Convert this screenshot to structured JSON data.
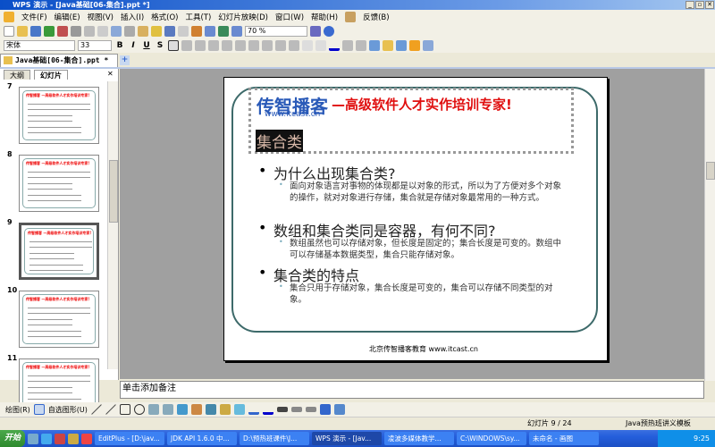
{
  "window": {
    "title": "WPS 演示 - [Java基础[06-集合].ppt *]",
    "min": "_",
    "max": "▫",
    "close": "✕"
  },
  "menu": [
    "文件(F)",
    "编辑(E)",
    "视图(V)",
    "插入(I)",
    "格式(O)",
    "工具(T)",
    "幻灯片放映(D)",
    "窗口(W)",
    "帮助(H)",
    "反馈(B)"
  ],
  "toolbar": {
    "zoom": "70 %",
    "font": "宋体",
    "size": "33",
    "bold": "B",
    "italic": "I",
    "underline": "U",
    "shadow": "S"
  },
  "doc_tab": {
    "label": "Java基础[06-集合].ppt",
    "modified": "*",
    "close": "✕",
    "new": "+"
  },
  "panel": {
    "tabs": [
      "大纲",
      "幻灯片"
    ],
    "close": "✕"
  },
  "thumbnails": [
    {
      "num": "7"
    },
    {
      "num": "8"
    },
    {
      "num": "9",
      "selected": true
    },
    {
      "num": "10"
    },
    {
      "num": "11"
    }
  ],
  "slide": {
    "logo": "传智播客",
    "logo_url": "www.itcast.cn",
    "slogan": "—高级软件人才实作培训专家!",
    "title": "集合类",
    "bullets": [
      {
        "text": "为什么出现集合类?",
        "sub": "面向对象语言对事物的体现都是以对象的形式，所以为了方便对多个对象的操作，就对对象进行存储，集合就是存储对象最常用的一种方式。"
      },
      {
        "text": "数组和集合类同是容器，有何不同?",
        "sub": "数组虽然也可以存储对象，但长度是固定的；集合长度是可变的。数组中可以存储基本数据类型，集合只能存储对象。"
      },
      {
        "text": "集合类的特点",
        "sub": "集合只用于存储对象，集合长度是可变的，集合可以存储不同类型的对象。"
      }
    ],
    "footer": "北京传智播客教育 www.itcast.cn"
  },
  "notes": {
    "placeholder": "单击添加备注"
  },
  "drawbar": {
    "draw": "绘图(R)",
    "autoshapes": "自选图形(U)"
  },
  "status": {
    "slide": "幻灯片 9 / 24",
    "template": "Java预热班讲义模板"
  },
  "taskbar": {
    "start": "开始",
    "tasks": [
      "EditPlus - [D:\\jav...",
      "JDK API 1.6.0 中...",
      "D:\\预热班课件\\J...",
      "WPS 演示 - [Jav...",
      "凌波多媒体教学...",
      "C:\\WINDOWS\\sy...",
      "未命名 - 画图"
    ],
    "active": 3,
    "time": "9:25"
  }
}
